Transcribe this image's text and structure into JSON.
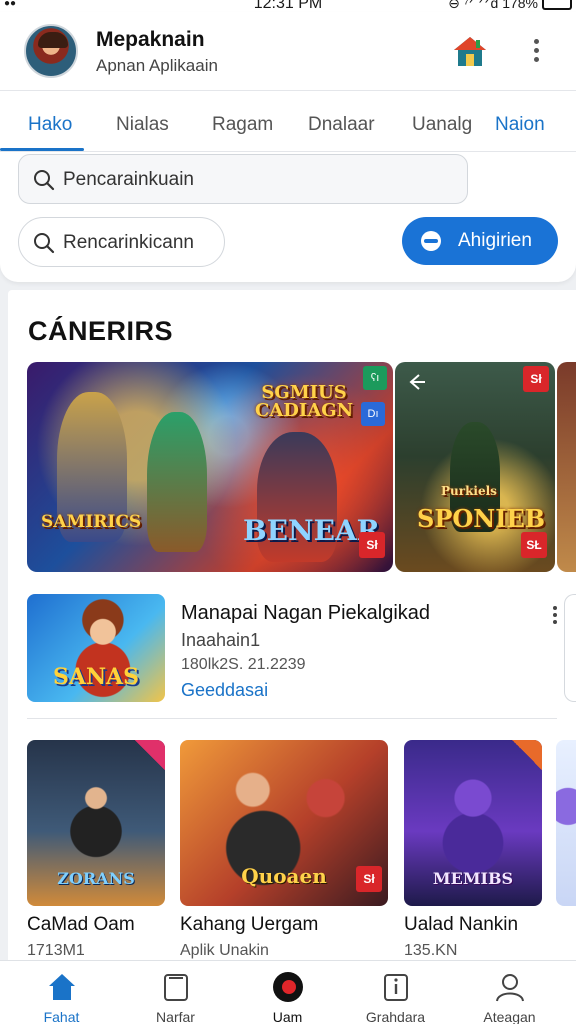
{
  "status_bar": {
    "time": "12:31 PM",
    "indicators": "⊖ ⁷ᐟ ᐟᐟd 178%"
  },
  "header": {
    "app_name": "Mepaknain",
    "subtitle": "Apnan Aplikaain",
    "home_icon": "home-icon",
    "more_icon": "more-vertical-icon"
  },
  "tabs": [
    {
      "label": "Hako",
      "active": true
    },
    {
      "label": "Nialas",
      "active": false
    },
    {
      "label": "Ragam",
      "active": false
    },
    {
      "label": "Dnalaar",
      "active": false
    },
    {
      "label": "Uanalg",
      "active": false
    },
    {
      "label": "Naion",
      "active": false
    }
  ],
  "search": {
    "primary_placeholder": "Pencarainkuain",
    "secondary_placeholder": "Rencarinkicann"
  },
  "primary_button": {
    "label": "Ahigirien",
    "color": "#1a73d6"
  },
  "section": {
    "title": "CÁNERIRS"
  },
  "banners": [
    {
      "logo_top": "SGMIUS\nCADIAGN",
      "logo_bottom": "BENEAR",
      "logo_side": "SAMIRICS",
      "badge_top": "ʕı",
      "badge_mid": "Dı",
      "badge_bottom": "Sł"
    },
    {
      "logo_top": "Purkiels",
      "logo_bottom": "SPONIEB",
      "badge_top": "Sł",
      "badge_bottom": "SŁ"
    }
  ],
  "featured": {
    "title": "Manapai Nagan Piekalgikad",
    "subtitle": "Inaahain1",
    "meta": "180lk2S. 21.2239",
    "link": "Geeddasai",
    "thumb_logo": "SANAS"
  },
  "games": [
    {
      "name": "CaMad Oam",
      "meta": "1713M1",
      "logo": "ZORANS"
    },
    {
      "name": "Kahang Uergam",
      "meta": "Aplik Unakin",
      "logo": "Quoaen"
    },
    {
      "name": "Ualad Nankin",
      "meta": "135.KN",
      "logo": "MEMIBS"
    }
  ],
  "bottom_nav": [
    {
      "label": "Fahat",
      "icon": "home-icon",
      "active": true
    },
    {
      "label": "Narfar",
      "icon": "tablet-icon",
      "active": false
    },
    {
      "label": "Uam",
      "icon": "record-icon",
      "active": false
    },
    {
      "label": "Grahdara",
      "icon": "info-icon",
      "active": false
    },
    {
      "label": "Ateagan",
      "icon": "person-icon",
      "active": false
    }
  ],
  "colors": {
    "accent": "#1a73c8",
    "button": "#1a73d6",
    "background": "#eef0f3"
  }
}
